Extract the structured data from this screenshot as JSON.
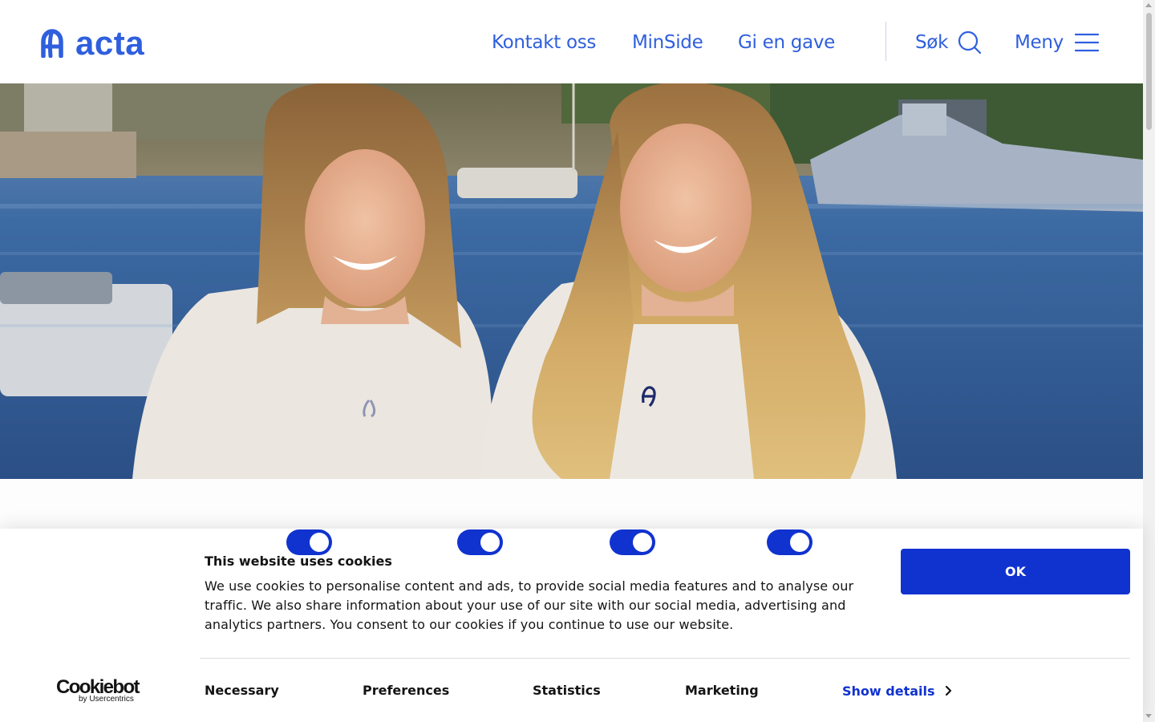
{
  "header": {
    "logo_text": "acta",
    "nav": {
      "contact": "Kontakt oss",
      "minside": "MinSide",
      "gift": "Gi en gave"
    },
    "search_label": "Søk",
    "menu_label": "Meny",
    "search_icon": "search-icon",
    "menu_icon": "hamburger-menu-icon"
  },
  "hero": {
    "image": "two-smiling-young-women-in-white-acta-sweatshirts-by-harbour"
  },
  "cookie_banner": {
    "title": "This website uses cookies",
    "text": "We use cookies to personalise content and ads, to provide social media features and to analyse our traffic. We also share information about your use of our site with our social media, advertising and analytics partners. You consent to our cookies if you continue to use our website.",
    "ok_label": "OK",
    "provider_name": "Cookiebot",
    "provider_sub": "by Usercentrics",
    "categories": [
      {
        "label": "Necessary",
        "enabled": true
      },
      {
        "label": "Preferences",
        "enabled": true
      },
      {
        "label": "Statistics",
        "enabled": true
      },
      {
        "label": "Marketing",
        "enabled": true
      }
    ],
    "show_details_label": "Show details"
  },
  "colors": {
    "brand_blue": "#2f5fde",
    "cookie_blue": "#1032cf",
    "text_dark": "#141414"
  }
}
